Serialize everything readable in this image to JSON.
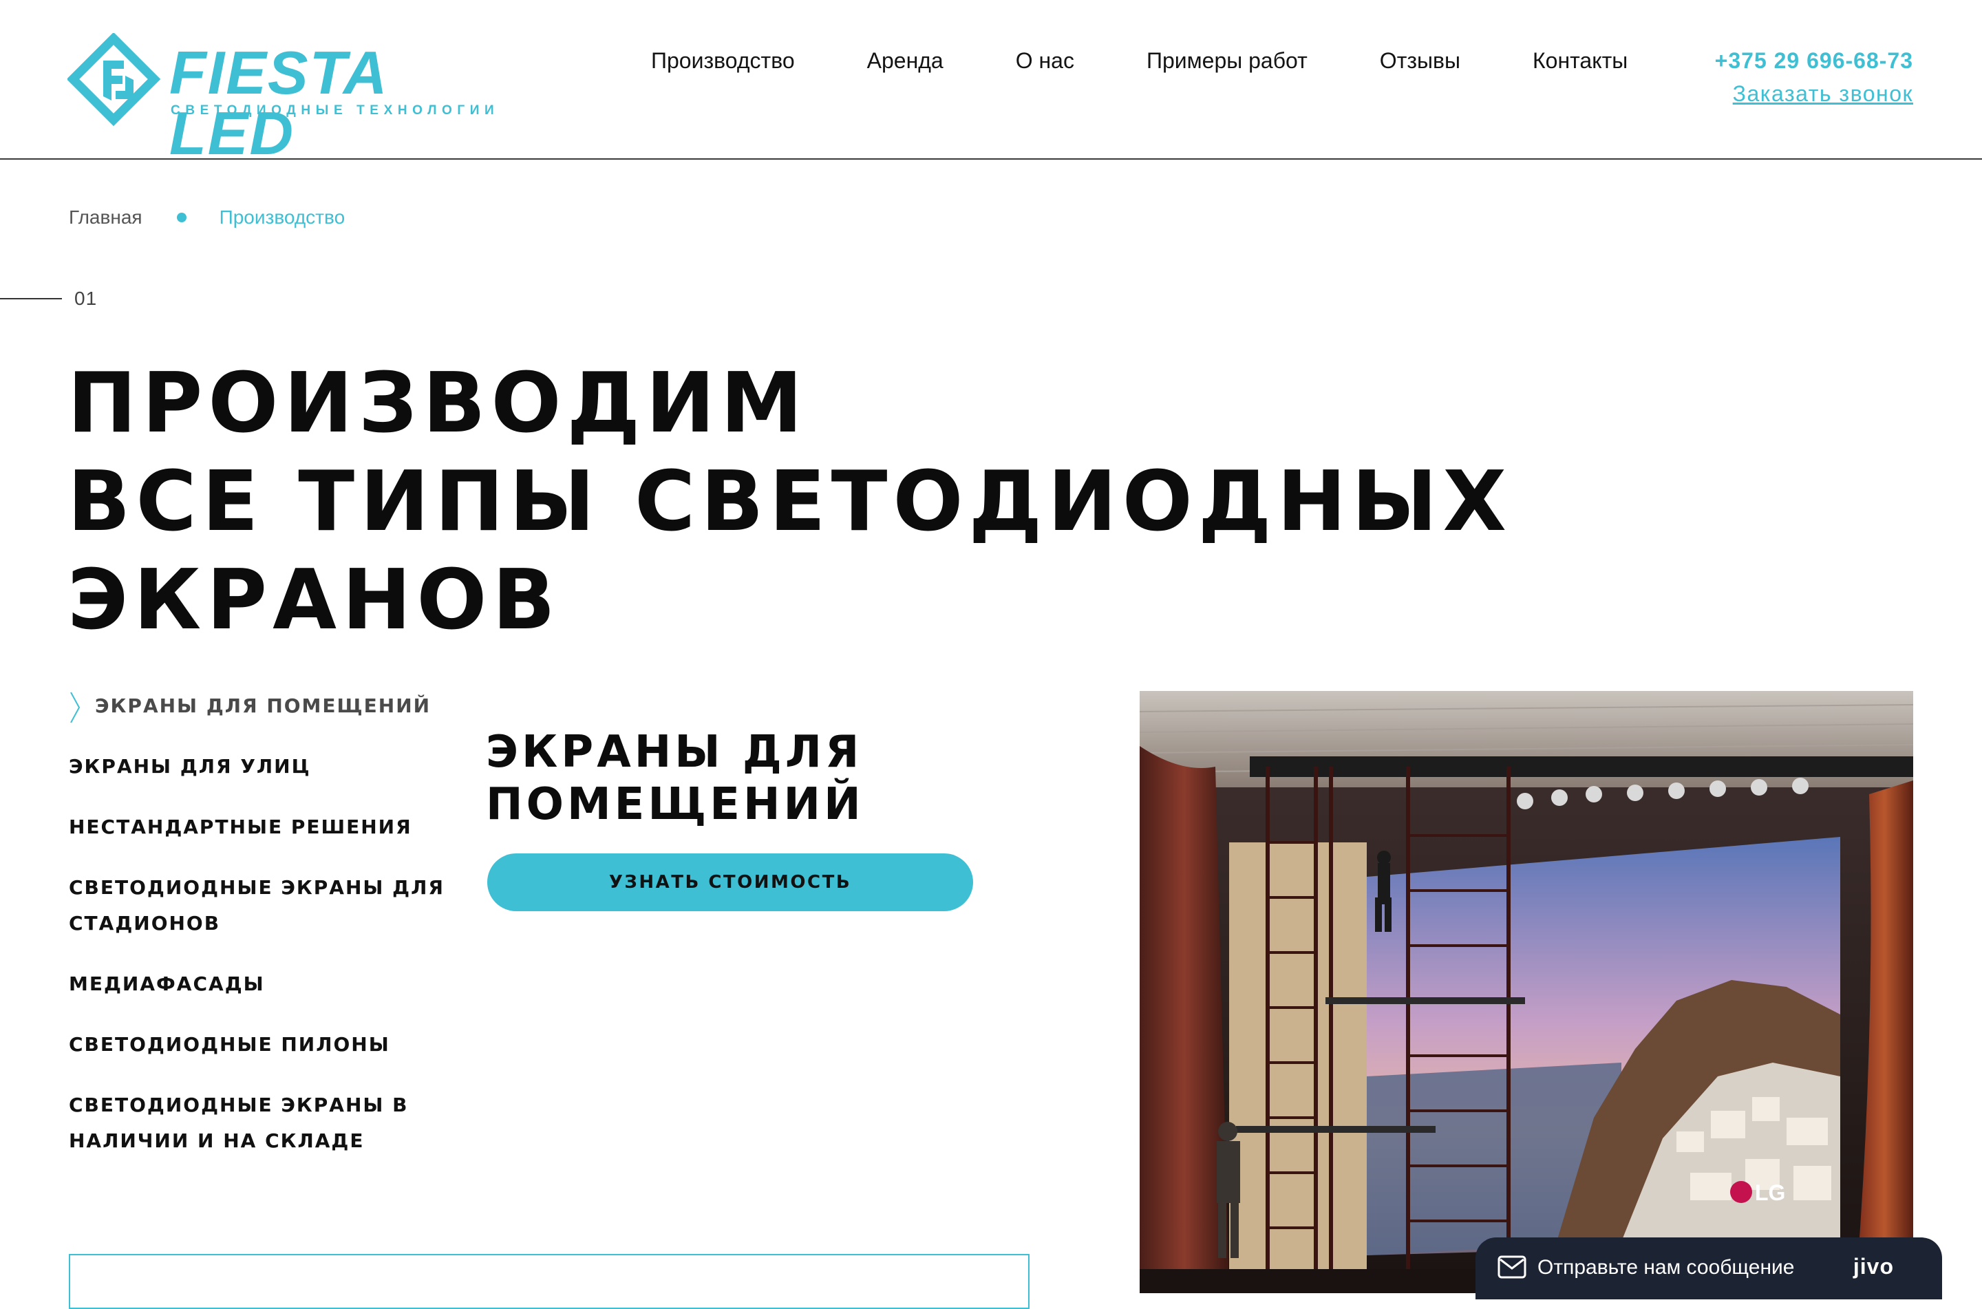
{
  "brand": {
    "name": "FIESTA LED",
    "tagline": "СВЕТОДИОДНЫЕ ТЕХНОЛОГИИ",
    "accent_color": "#3fbfd3"
  },
  "nav": {
    "items": [
      {
        "label": "Производство"
      },
      {
        "label": "Аренда"
      },
      {
        "label": "О нас"
      },
      {
        "label": "Примеры работ"
      },
      {
        "label": "Отзывы"
      },
      {
        "label": "Контакты"
      }
    ]
  },
  "contact": {
    "phone": "+375 29 696-68-73",
    "callback": "Заказать звонок"
  },
  "breadcrumb": {
    "home": "Главная",
    "current": "Производство"
  },
  "section": {
    "number": "01"
  },
  "hero": {
    "lines": [
      "ПРОИЗВОДИМ",
      "ВСЕ ТИПЫ СВЕТОДИОДНЫХ",
      "ЭКРАНОВ"
    ]
  },
  "categories": [
    {
      "label": "ЭКРАНЫ ДЛЯ ПОМЕЩЕНИЙ",
      "active": true
    },
    {
      "label": "ЭКРАНЫ ДЛЯ УЛИЦ"
    },
    {
      "label": "НЕСТАНДАРТНЫЕ РЕШЕНИЯ"
    },
    {
      "label": "СВЕТОДИОДНЫЕ ЭКРАНЫ ДЛЯ СТАДИОНОВ"
    },
    {
      "label": "МЕДИАФАСАДЫ"
    },
    {
      "label": "СВЕТОДИОДНЫЕ ПИЛОНЫ"
    },
    {
      "label": "СВЕТОДИОДНЫЕ ЭКРАНЫ В НАЛИЧИИ И НА СКЛАДЕ"
    }
  ],
  "detail": {
    "title": "ЭКРАНЫ ДЛЯ ПОМЕЩЕНИЙ",
    "cta": "УЗНАТЬ СТОИМОСТЬ"
  },
  "photo": {
    "screen_brand": "LG"
  },
  "chat": {
    "message": "Отправьте нам сообщение",
    "brand": "jivo"
  }
}
